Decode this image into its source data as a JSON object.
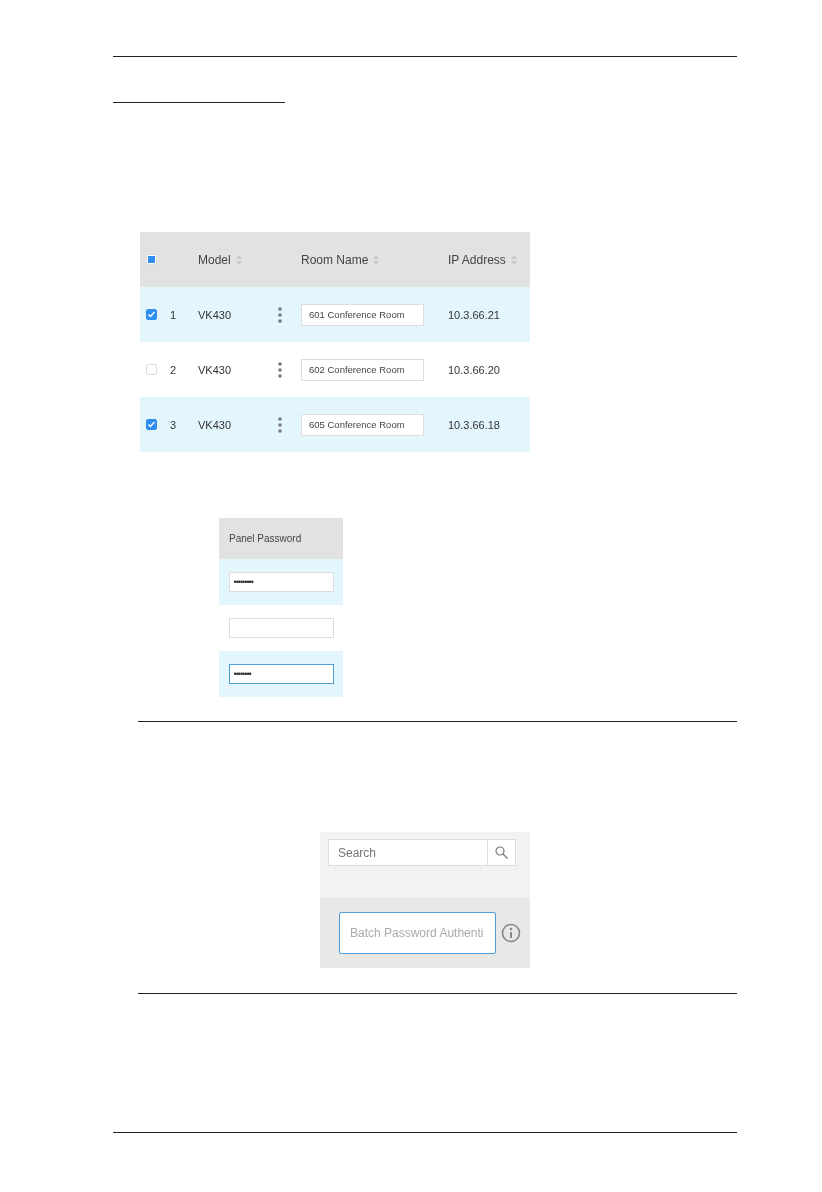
{
  "device_table": {
    "select_all_indeterminate": true,
    "columns": [
      "Model",
      "Room Name",
      "IP Address"
    ],
    "rows": [
      {
        "selected": true,
        "index": "1",
        "model": "VK430",
        "room_name": "601 Conference Room",
        "ip_address": "10.3.66.21"
      },
      {
        "selected": false,
        "index": "2",
        "model": "VK430",
        "room_name": "602 Conference Room",
        "ip_address": "10.3.66.20"
      },
      {
        "selected": true,
        "index": "3",
        "model": "VK430",
        "room_name": "605 Conference Room",
        "ip_address": "10.3.66.18"
      }
    ]
  },
  "password_panel": {
    "column": "Panel Password",
    "rows": [
      {
        "selected": true,
        "focused": false,
        "value": "•••••••••"
      },
      {
        "selected": false,
        "focused": false
      },
      {
        "selected": true,
        "focused": true,
        "value": "••••••••"
      }
    ]
  },
  "search_panel": {
    "search": {
      "placeholder": "Search"
    },
    "batch_password": {
      "placeholder": "Batch Password Authenti",
      "focused": true
    }
  }
}
